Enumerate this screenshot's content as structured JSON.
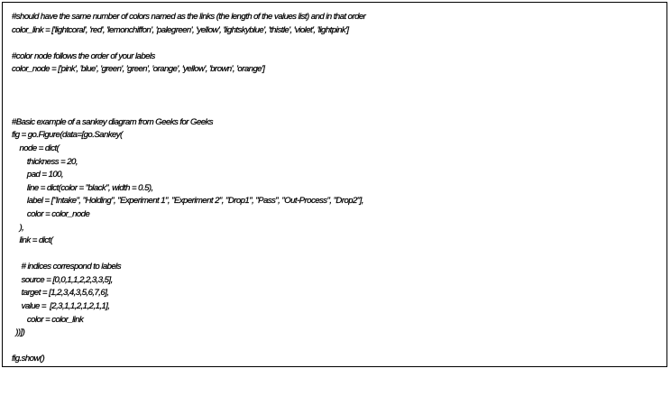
{
  "code": {
    "lines": [
      "#should have the same number of colors named as the links (the length of the values list) and in that order",
      "color_link = ['lightcoral', 'red', 'lemonchiffon', 'palegreen', 'yellow', 'lightskyblue', 'thistle', 'violet', 'lightpink']",
      "",
      "#color node follows the order of your labels",
      "color_node = ['pink', 'blue', 'green', 'green', 'orange', 'yellow', 'brown', 'orange']",
      "",
      "",
      "",
      "#Basic example of a sankey diagram from Geeks for Geeks",
      "fig = go.Figure(data=[go.Sankey(",
      "    node = dict(",
      "        thickness = 20,",
      "        pad = 100,",
      "        line = dict(color = \"black\", width = 0.5),",
      "        label = [\"Intake\", \"Holding\", \"Experiment 1\", \"Experiment 2\", \"Drop1\", \"Pass\", \"Out-Process\", \"Drop2\"],",
      "        color = color_node",
      "    ),",
      "    link = dict(",
      "",
      "     # indices correspond to labels",
      "     source = [0,0,1,1,2,2,3,3,5],",
      "     target = [1,2,3,4,3,5,6,7,6],",
      "     value =  [2,3,1,1,2,1,2,1,1],",
      "        color = color_link",
      "  ))])",
      "",
      "fig.show()"
    ]
  }
}
